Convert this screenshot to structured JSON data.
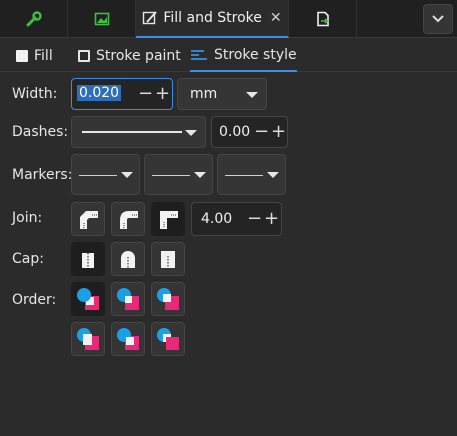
{
  "dock": {
    "active_tab_title": "Fill and Stroke",
    "close_glyph": "✕",
    "tabs": [
      "wrench-icon",
      "image-icon",
      "fill-stroke-icon",
      "export-icon"
    ]
  },
  "subtabs": [
    {
      "label": "Fill"
    },
    {
      "label": "Stroke paint"
    },
    {
      "label": "Stroke style"
    }
  ],
  "labels": {
    "width": "Width:",
    "dashes": "Dashes:",
    "markers": "Markers:",
    "join": "Join:",
    "cap": "Cap:",
    "order": "Order:"
  },
  "width": {
    "value": "0.020",
    "unit": "mm"
  },
  "dashes": {
    "offset": "0.00"
  },
  "join": {
    "miter_limit": "4.00"
  },
  "colors": {
    "accent": "#3a8ee6",
    "marker_blue": "#1aa0e8",
    "marker_pink": "#e8287a"
  }
}
